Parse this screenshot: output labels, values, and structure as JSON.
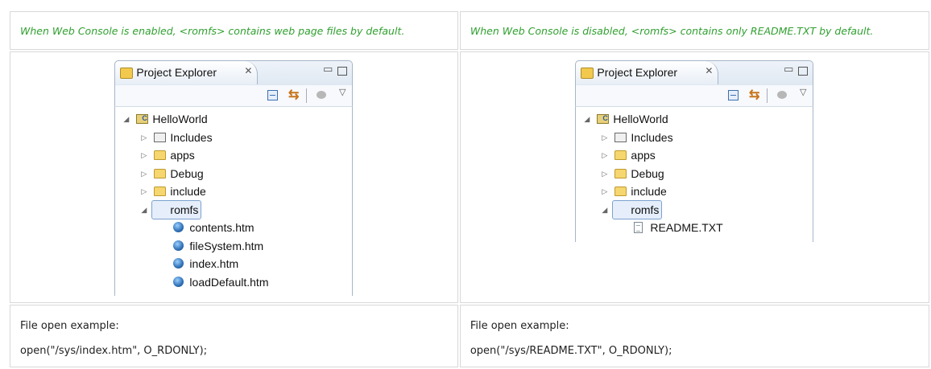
{
  "columns": [
    {
      "note": "When Web Console is enabled, <romfs> contains web page files by default.",
      "explorer": {
        "title": "Project Explorer",
        "project": "HelloWorld",
        "folders": [
          "Includes",
          "apps",
          "Debug",
          "include"
        ],
        "expanded_folder": "romfs",
        "files": [
          "contents.htm",
          "fileSystem.htm",
          "index.htm",
          "loadDefault.htm"
        ]
      },
      "example_label": "File open example:",
      "example_code": "open(\"/sys/index.htm\", O_RDONLY);"
    },
    {
      "note": "When Web Console is disabled, <romfs> contains only README.TXT by default.",
      "explorer": {
        "title": "Project Explorer",
        "project": "HelloWorld",
        "folders": [
          "Includes",
          "apps",
          "Debug",
          "include"
        ],
        "expanded_folder": "romfs",
        "files": [
          "README.TXT"
        ]
      },
      "example_label": "File open example:",
      "example_code": "open(\"/sys/README.TXT\", O_RDONLY);"
    }
  ],
  "icons": {
    "tab_close": "✕",
    "minimize": "▭",
    "view_menu": "▽",
    "expanded": "◢",
    "collapsed": "▷",
    "link_editor": "⇆"
  }
}
